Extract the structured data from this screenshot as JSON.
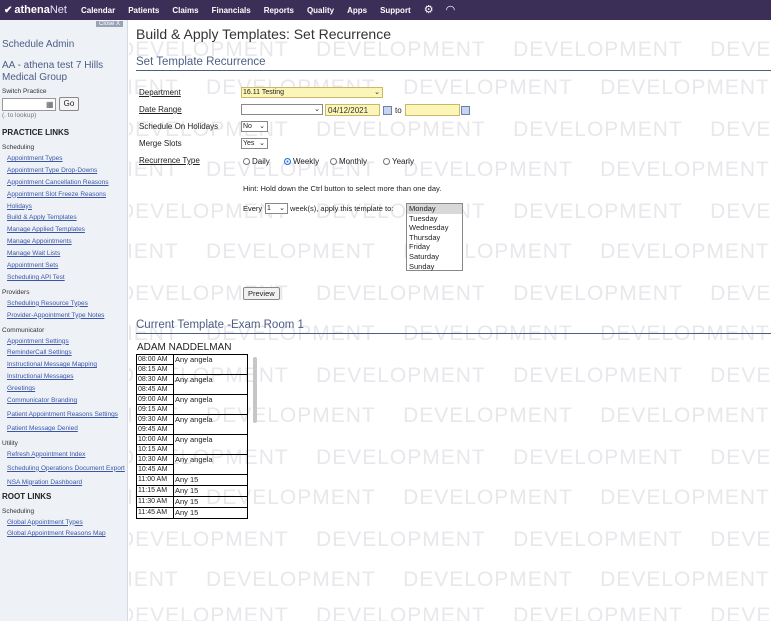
{
  "nav": {
    "logo_main": "athena",
    "logo_net": "Net",
    "items": [
      "Calendar",
      "Patients",
      "Claims",
      "Financials",
      "Reports",
      "Quality",
      "Apps",
      "Support"
    ]
  },
  "sidebar": {
    "close_label": "Close X",
    "title": "Schedule Admin",
    "practice_name": "AA - athena test 7 Hills Medical Group",
    "switch_label": "Switch Practice",
    "switch_input_value": "",
    "go_label": "Go",
    "lookup_hint": "(. to lookup)",
    "practice_links_heading": "PRACTICE LINKS",
    "groups": [
      {
        "label": "Scheduling",
        "links": [
          "Appointment Types",
          "Appointment Type Drop-Downs",
          "Appointment Cancellation Reasons",
          "Appointment Slot Freeze Reasons",
          "Holidays",
          "Build & Apply Templates",
          "Manage Applied Templates",
          "Manage Appointments",
          "Manage Wait Lists",
          "Appointment Sets",
          "Scheduling API Test"
        ]
      },
      {
        "label": "Providers",
        "links": [
          "Scheduling Resource Types",
          "Provider-Appointment Type Notes"
        ]
      },
      {
        "label": "Communicator",
        "links": [
          "Appointment Settings",
          "ReminderCall Settings",
          "Instructional Message Mapping",
          "Instructional Messages",
          "Greetings",
          "Communicator Branding",
          "Patient Appointment Reasons Settings",
          "Patient Message Denied"
        ]
      },
      {
        "label": "Utility",
        "links": [
          "Refresh Appointment Index",
          "Scheduling Operations Document Export",
          "NSA Migration Dashboard"
        ]
      }
    ],
    "root_links_heading": "ROOT LINKS",
    "root_groups": [
      {
        "label": "Scheduling",
        "links": [
          "Global Appointment Types",
          "Global Appointment Reasons Map"
        ]
      }
    ]
  },
  "main": {
    "page_title": "Build & Apply Templates: Set Recurrence",
    "section_title": "Set Template Recurrence",
    "watermark": "DEVELOPMENT",
    "form": {
      "department_label": "Department",
      "department_value": "16.11 Testing",
      "date_range_label": "Date Range",
      "date_range_type_value": "",
      "date_start": "04/12/2021",
      "to_label": "to",
      "date_end": "",
      "holidays_label": "Schedule On Holidays",
      "holidays_value": "No",
      "merge_label": "Merge Slots",
      "merge_value": "Yes",
      "recurrence_label": "Recurrence Type",
      "recurrence_options": [
        "Daily",
        "Weekly",
        "Monthly",
        "Yearly"
      ],
      "recurrence_selected": "Weekly",
      "hint": "Hint: Hold down the Ctrl button to select more than one day.",
      "every_label": "Every",
      "every_value": "1",
      "every_suffix": "week(s), apply this template to:",
      "days": [
        "Monday",
        "Tuesday",
        "Wednesday",
        "Thursday",
        "Friday",
        "Saturday",
        "Sunday"
      ],
      "days_selected": "Monday",
      "preview_label": "Preview"
    },
    "current_template_title": "Current Template -Exam Room 1",
    "provider": "ADAM NADDELMAN",
    "slots": [
      {
        "times": [
          "08:00 AM",
          "08:15 AM"
        ],
        "name": "Any angela"
      },
      {
        "times": [
          "08:30 AM",
          "08:45 AM"
        ],
        "name": "Any angela"
      },
      {
        "times": [
          "09:00 AM",
          "09:15 AM"
        ],
        "name": "Any angela"
      },
      {
        "times": [
          "09:30 AM",
          "09:45 AM"
        ],
        "name": "Any angela"
      },
      {
        "times": [
          "10:00 AM",
          "10:15 AM"
        ],
        "name": "Any angela"
      },
      {
        "times": [
          "10:30 AM",
          "10:45 AM"
        ],
        "name": "Any angela"
      },
      {
        "times": [
          "11:00 AM"
        ],
        "name": "Any 15"
      },
      {
        "times": [
          "11:15 AM"
        ],
        "name": "Any 15"
      },
      {
        "times": [
          "11:30 AM"
        ],
        "name": "Any 15"
      },
      {
        "times": [
          "11:45 AM"
        ],
        "name": "Any 15"
      }
    ]
  }
}
